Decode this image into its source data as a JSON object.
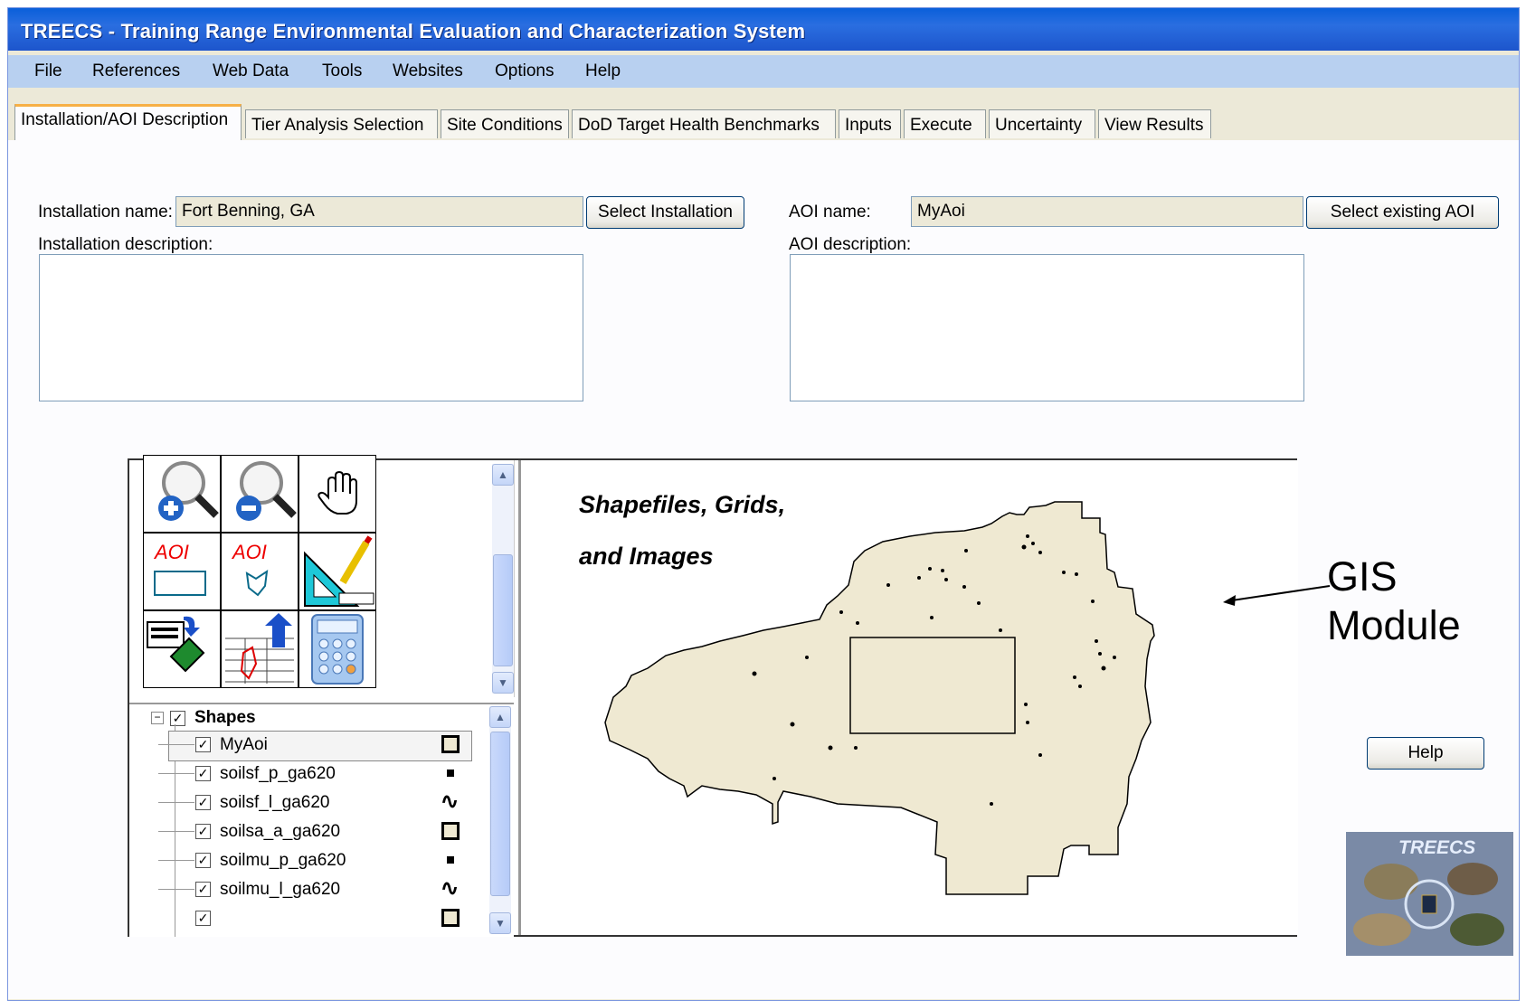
{
  "window": {
    "title": "TREECS - Training Range Environmental Evaluation and Characterization System"
  },
  "menu": [
    "File",
    "References",
    "Web Data",
    "Tools",
    "Websites",
    "Options",
    "Help"
  ],
  "tabs": [
    "Installation/AOI Description",
    "Tier Analysis Selection",
    "Site Conditions",
    "DoD Target Health Benchmarks",
    "Inputs",
    "Execute",
    "Uncertainty",
    "View Results"
  ],
  "installation": {
    "name_label": "Installation name:",
    "name_value": "Fort Benning, GA",
    "select_button": "Select Installation",
    "description_label": "Installation description:"
  },
  "aoi": {
    "name_label": "AOI name:",
    "name_value": "MyAoi",
    "select_button": "Select existing AOI",
    "description_label": "AOI description:"
  },
  "gis": {
    "toolbar": {
      "aoi_rect_label": "AOI",
      "aoi_poly_label": "AOI"
    },
    "legend": {
      "group": "Shapes",
      "layers": [
        {
          "name": "MyAoi",
          "symbol": "polygon"
        },
        {
          "name": "soilsf_p_ga620",
          "symbol": "point"
        },
        {
          "name": "soilsf_l_ga620",
          "symbol": "line"
        },
        {
          "name": "soilsa_a_ga620",
          "symbol": "polygon"
        },
        {
          "name": "soilmu_p_ga620",
          "symbol": "point"
        },
        {
          "name": "soilmu_l_ga620",
          "symbol": "line"
        }
      ]
    },
    "map_text_line1": "Shapefiles, Grids,",
    "map_text_line2": "and Images",
    "map_fill_color": "#efe9d2"
  },
  "callout": {
    "line1": "GIS",
    "line2": "Module"
  },
  "help_button": "Help",
  "logo_text": "TREECS"
}
